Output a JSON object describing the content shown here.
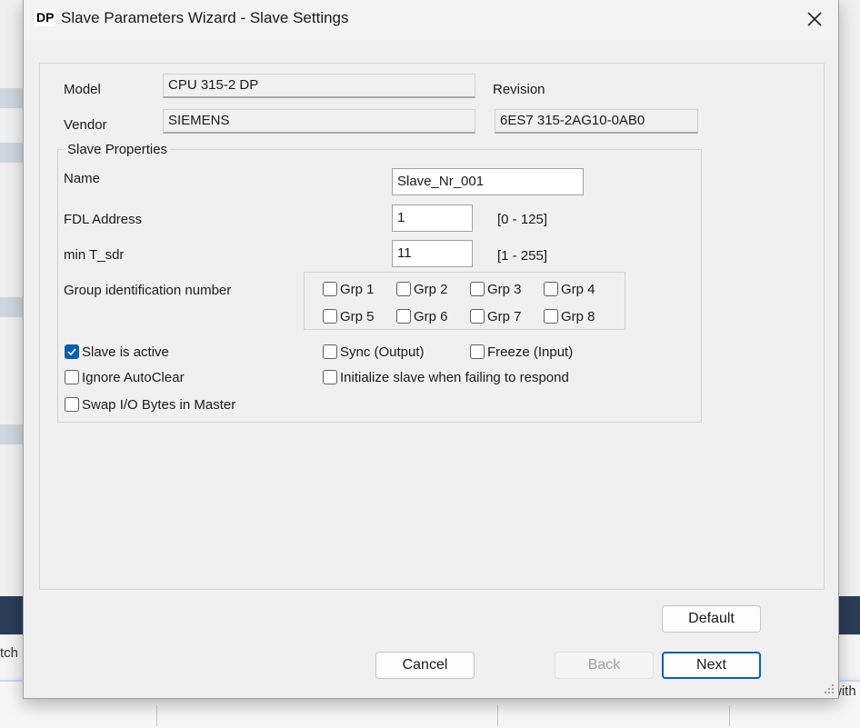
{
  "window": {
    "icon_text": "DP",
    "title": "Slave Parameters Wizard - Slave Settings"
  },
  "background": {
    "left_text": "tch",
    "right_text": "with"
  },
  "info": {
    "model_label": "Model",
    "model_value": "CPU 315-2 DP",
    "revision_label": "Revision",
    "vendor_label": "Vendor",
    "vendor_value": "SIEMENS",
    "order_number": "6ES7 315-2AG10-0AB0"
  },
  "slave_properties": {
    "title": "Slave Properties",
    "name_label": "Name",
    "name_value": "Slave_Nr_001",
    "fdl_label": "FDL Address",
    "fdl_value": "1",
    "fdl_range": "[0 - 125]",
    "tsdr_label": "min T_sdr",
    "tsdr_value": "11",
    "tsdr_range": "[1 - 255]",
    "group_label": "Group identification number",
    "groups": [
      {
        "label": "Grp 1",
        "checked": false
      },
      {
        "label": "Grp 2",
        "checked": false
      },
      {
        "label": "Grp 3",
        "checked": false
      },
      {
        "label": "Grp 4",
        "checked": false
      },
      {
        "label": "Grp 5",
        "checked": false
      },
      {
        "label": "Grp 6",
        "checked": false
      },
      {
        "label": "Grp 7",
        "checked": false
      },
      {
        "label": "Grp 8",
        "checked": false
      }
    ],
    "options": {
      "slave_active": {
        "label": "Slave is active",
        "checked": true
      },
      "ignore_autoclear": {
        "label": "Ignore AutoClear",
        "checked": false
      },
      "swap_io": {
        "label": "Swap I/O Bytes in Master",
        "checked": false
      },
      "sync_output": {
        "label": "Sync (Output)",
        "checked": false
      },
      "freeze_input": {
        "label": "Freeze (Input)",
        "checked": false
      },
      "init_slave": {
        "label": "Initialize slave when failing to respond",
        "checked": false
      }
    }
  },
  "buttons": {
    "default": "Default",
    "cancel": "Cancel",
    "back": "Back",
    "next": "Next"
  },
  "colors": {
    "accent": "#0a5fb4",
    "dialog_bg": "#f0f0f0"
  }
}
